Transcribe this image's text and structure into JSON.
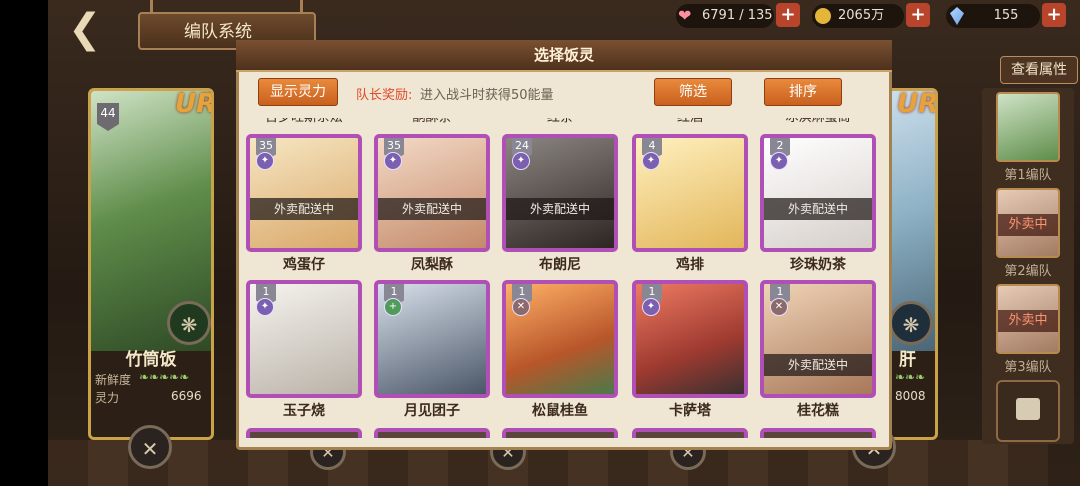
{
  "header": {
    "title": "编队系统"
  },
  "top_bar": {
    "stamina": "6791 / 135",
    "gold": "2065万",
    "gems": "155"
  },
  "left_card": {
    "level": "44",
    "rarity": "UR",
    "name": "竹筒饭",
    "freshness_label": "新鲜度",
    "power_label": "灵力",
    "power_value": "6696"
  },
  "right_card": {
    "rarity": "UR",
    "name_fragment": "肝",
    "power_value": "8008"
  },
  "right_panel": {
    "view_attributes": "查看属性",
    "teams": [
      {
        "label": "第1编队",
        "badge": ""
      },
      {
        "label": "第2编队",
        "badge": "外卖中"
      },
      {
        "label": "第3编队",
        "badge": "外卖中"
      }
    ]
  },
  "modal": {
    "title": "选择饭灵",
    "show_power_button": "显示灵力",
    "captain_bonus_label": "队长奖励:",
    "captain_bonus_text": "进入战斗时获得50能量",
    "filter_button": "筛选",
    "sort_button": "排序",
    "cut_top_names": [
      "吉罗旺斯杂烩",
      "酮酥茶",
      "红茶",
      "红酒",
      "冰淇淋蛋筒"
    ],
    "cards": [
      {
        "level": "35",
        "name": "鸡蛋仔",
        "status": "外卖配送中",
        "art": "#e4c59a"
      },
      {
        "level": "35",
        "name": "凤梨酥",
        "status": "外卖配送中",
        "art": "#d9a98a"
      },
      {
        "level": "24",
        "name": "布朗尼",
        "status": "外卖配送中",
        "art": "#4a3a36"
      },
      {
        "level": "4",
        "name": "鸡排",
        "status": "",
        "art": "#f0d48a"
      },
      {
        "level": "2",
        "name": "珍珠奶茶",
        "status": "外卖配送中",
        "art": "#eee9e6"
      },
      {
        "level": "1",
        "name": "玉子烧",
        "status": "",
        "art": "#e6e2dc"
      },
      {
        "level": "1",
        "name": "月见团子",
        "status": "",
        "art": "#9aa7b8"
      },
      {
        "level": "1",
        "name": "松鼠桂鱼",
        "status": "",
        "art": "#f08a3c"
      },
      {
        "level": "1",
        "name": "卡萨塔",
        "status": "",
        "art": "#d0564a"
      },
      {
        "level": "1",
        "name": "桂花糕",
        "status": "外卖配送中",
        "art": "#c99a78"
      }
    ]
  }
}
